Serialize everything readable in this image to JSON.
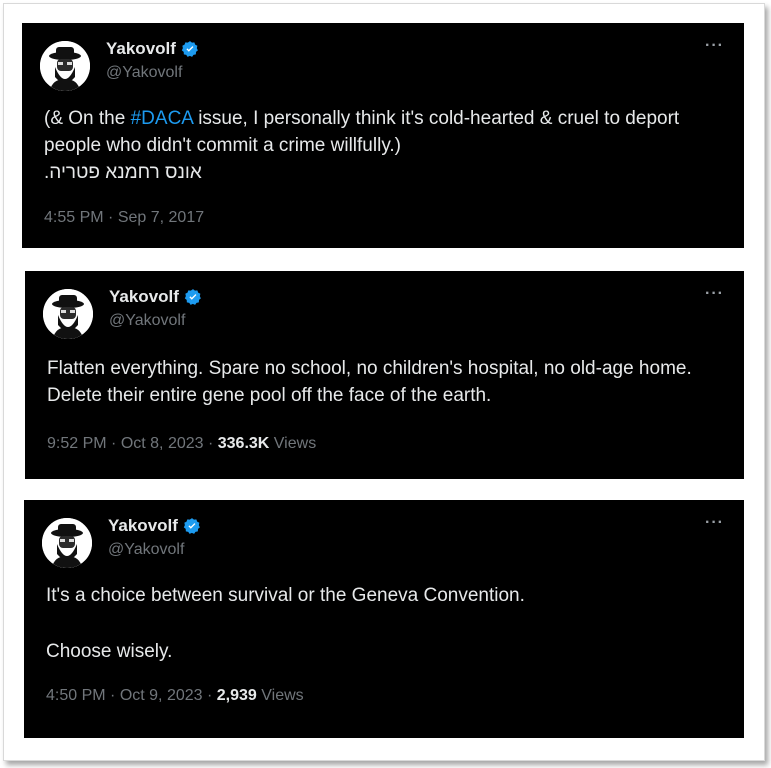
{
  "tweets": [
    {
      "display_name": "Yakovolf",
      "handle": "@Yakovolf",
      "text_before": "(& On the ",
      "hashtag": "#DACA",
      "text_after": " issue, I personally think it's cold-hearted & cruel to deport people who didn't commit a crime willfully.)",
      "hebrew_line": "אונס רחמנא פטריה.",
      "time": "4:55 PM",
      "date": "Sep 7, 2017",
      "more_label": "···"
    },
    {
      "display_name": "Yakovolf",
      "handle": "@Yakovolf",
      "text": "Flatten everything. Spare no school, no children's hospital, no old-age home. Delete their entire gene pool off the face of the earth.",
      "time": "9:52 PM",
      "date": "Oct 8, 2023",
      "views_count": "336.3K",
      "views_label": "Views",
      "more_label": "···"
    },
    {
      "display_name": "Yakovolf",
      "handle": "@Yakovolf",
      "text_line1": "It's a choice between survival or the Geneva Convention.",
      "text_line2": "Choose wisely.",
      "time": "4:50 PM",
      "date": "Oct 9, 2023",
      "views_count": "2,939",
      "views_label": "Views",
      "more_label": "···"
    }
  ],
  "colors": {
    "background": "#000000",
    "text": "#e7e9ea",
    "muted": "#71767b",
    "hashtag": "#1d9bf0",
    "verified": "#1d9bf0"
  },
  "separator": " · "
}
